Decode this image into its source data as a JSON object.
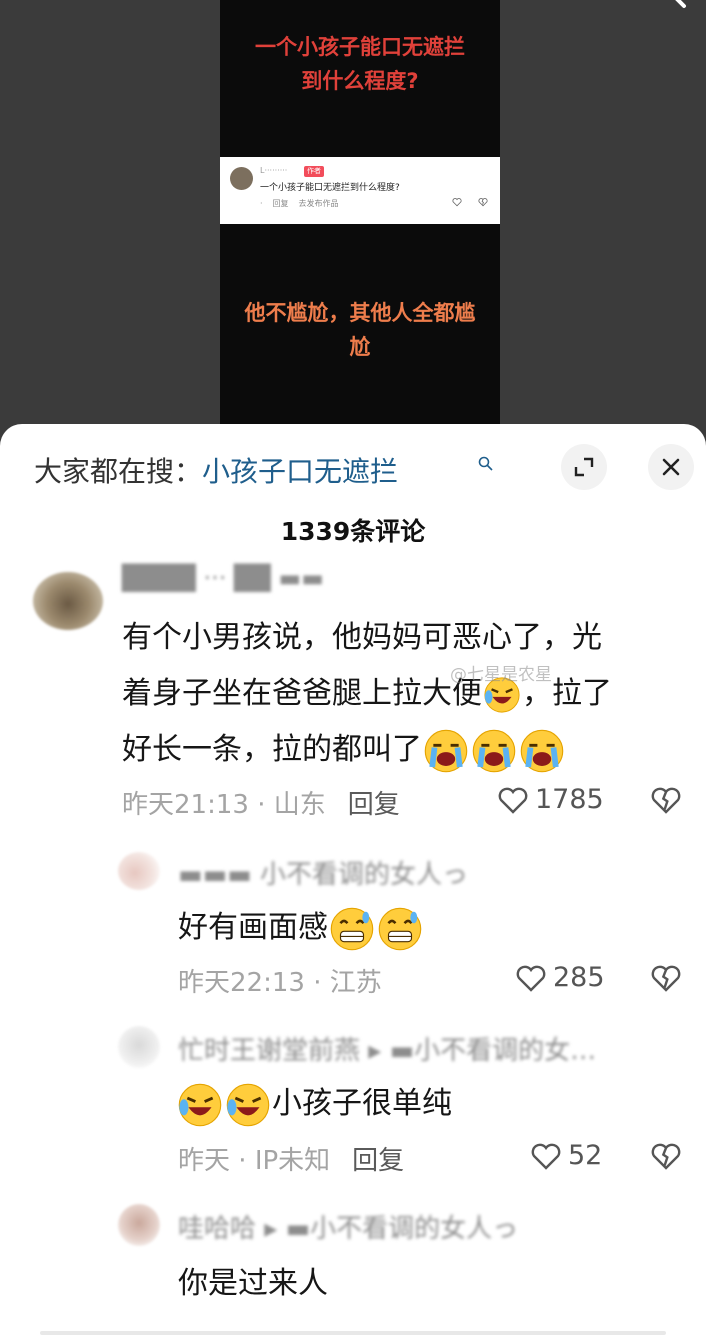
{
  "video": {
    "caption_top": "一个小孩子能口无遮拦到什么程度?",
    "caption_bottom": "他不尴尬，其他人全都尴尬",
    "mini_comment": {
      "badge": "作者",
      "text": "一个小孩子能口无遮拦到什么程度?",
      "actions": [
        "回复",
        "去发布作品"
      ]
    }
  },
  "sheet": {
    "suggest_prefix": "大家都在搜：",
    "suggest_term": "小孩子口无遮拦",
    "comment_count": "1339条评论",
    "watermark": "@七星是农星"
  },
  "comments": [
    {
      "text_lines": [
        "有个小男孩说，他妈妈可恶心了，光",
        "着身子坐在爸爸腿上拉大便",
        "好长一条，拉的都叫了"
      ],
      "line2_tail": "，拉了",
      "time": "昨天21:13",
      "location": "山东",
      "reply": "回复",
      "likes": "1785"
    },
    {
      "text": "好有画面感",
      "time": "昨天22:13",
      "location": "江苏",
      "likes": "285"
    },
    {
      "text": "小孩子很单纯",
      "time": "昨天",
      "location": "IP未知",
      "reply": "回复",
      "likes": "52"
    },
    {
      "text": "你是过来人"
    }
  ],
  "colors": {
    "caption_top": "#e0413a",
    "caption_bottom": "#ee7d4c",
    "suggest_term": "#1f5e8c",
    "badge": "#f24d5b"
  },
  "icons": [
    "search-icon",
    "expand-icon",
    "close-icon",
    "heart-icon",
    "broken-heart-icon",
    "laughing-crying-emoji",
    "crying-emoji",
    "grimace-sweat-emoji"
  ]
}
